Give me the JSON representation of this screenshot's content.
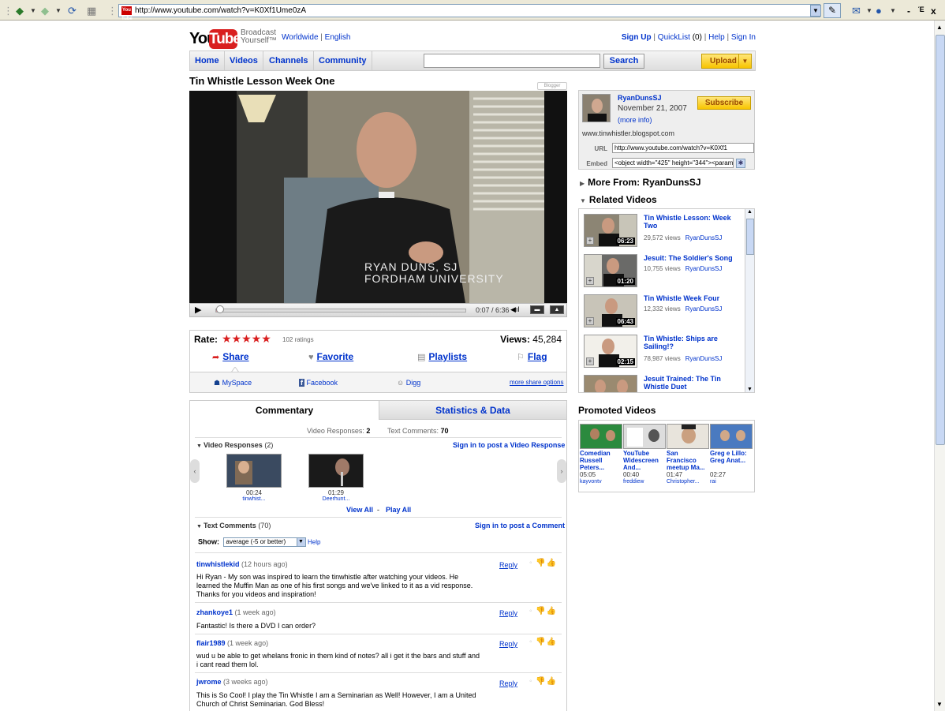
{
  "browser": {
    "url": "http://www.youtube.com/watch?v=K0Xf1Ume0zA",
    "favicon": "You Tube",
    "min": "-",
    "max": "Έ",
    "close": "x"
  },
  "header": {
    "logo_you": "You",
    "logo_tube": "Tube",
    "tagline_1": "Broadcast",
    "tagline_2": "Yourself™",
    "worldwide": "Worldwide",
    "divider": "|",
    "language": "English",
    "signup": "Sign Up",
    "quicklist": "QuickList",
    "quicklist_count": "(0)",
    "help": "Help",
    "signin": "Sign In"
  },
  "nav": {
    "tabs": [
      "Home",
      "Videos",
      "Channels",
      "Community"
    ],
    "search_value": "",
    "search_label": "Search",
    "upload_label": "Upload"
  },
  "video": {
    "title": "Tin Whistle Lesson Week One",
    "blogger_badge": "Blogger",
    "caption_line1": "RYAN DUNS, SJ",
    "caption_line2": "FORDHAM UNIVERSITY",
    "time": "0:07 / 6:36",
    "progress_fraction": 0.018
  },
  "rating": {
    "label": "Rate:",
    "stars": "★★★★★",
    "count": "102 ratings",
    "views_label": "Views:",
    "views": "45,284",
    "actions": {
      "share": "Share",
      "favorite": "Favorite",
      "playlists": "Playlists",
      "flag": "Flag"
    },
    "share_sites": {
      "myspace": "MySpace",
      "facebook": "Facebook",
      "digg": "Digg",
      "more": "more share options"
    }
  },
  "commentary": {
    "tab_active": "Commentary",
    "tab_other": "Statistics & Data",
    "video_responses_label": "Video Responses:",
    "video_responses_count": "2",
    "text_comments_label": "Text Comments:",
    "text_comments_count": "70",
    "vr_header": "Video Responses",
    "vr_header_count": "(2)",
    "vr_signin": "Sign in to post a Video Response",
    "responses": [
      {
        "time": "00:24",
        "user": "tinwhist..."
      },
      {
        "time": "01:29",
        "user": "Deerhunt..."
      }
    ],
    "view_all": "View All",
    "dash": "-",
    "play_all": "Play All",
    "tc_header": "Text Comments",
    "tc_header_count": "(70)",
    "tc_signin": "Sign in to post a Comment",
    "show_label": "Show:",
    "show_value": "average (-5 or better)",
    "help": "Help",
    "reply": "Reply",
    "comments": [
      {
        "user": "tinwhistlekid",
        "time": "(12 hours ago)",
        "text": "Hi Ryan - My son was inspired to learn the tinwhistle after watching your videos. He learned the Muffin Man as one of his first songs and we've linked to it as a vid response. Thanks for you videos and inspiration!"
      },
      {
        "user": "zhankoye1",
        "time": "(1 week ago)",
        "text": "Fantastic! Is there a DVD I can order?"
      },
      {
        "user": "flair1989",
        "time": "(1 week ago)",
        "text": "wud u be able to get whelans fronic in them kind of notes? all i get it the bars and stuff and i cant read them lol."
      },
      {
        "user": "jwrome",
        "time": "(3 weeks ago)",
        "text": "This is So Cool! I play the Tin Whistle I am a Seminarian as Well! However, I am a United Church of Christ Seminarian. God Bless!"
      }
    ]
  },
  "uploader": {
    "name": "RyanDunsSJ",
    "date": "November 21, 2007",
    "more_info": "(more info)",
    "site": "www.tinwhistler.blogspot.com",
    "subscribe": "Subscribe",
    "url_label": "URL",
    "url_value": "http://www.youtube.com/watch?v=K0Xf1",
    "embed_label": "Embed",
    "embed_value": "<object width=\"425\" height=\"344\"><param"
  },
  "sidebar": {
    "more_from": "More From: RyanDunsSJ",
    "related_header": "Related Videos",
    "related": [
      {
        "title": "Tin Whistle Lesson: Week Two",
        "views": "29,572 views",
        "user": "RyanDunsSJ",
        "duration": "06:23"
      },
      {
        "title": "Jesuit: The Soldier's Song",
        "views": "10,755 views",
        "user": "RyanDunsSJ",
        "duration": "01:20"
      },
      {
        "title": "Tin Whistle Week Four",
        "views": "12,332 views",
        "user": "RyanDunsSJ",
        "duration": "06:43"
      },
      {
        "title": "Tin Whistle: Ships are Sailing!?",
        "views": "78,987 views",
        "user": "RyanDunsSJ",
        "duration": "02:15"
      },
      {
        "title": "Jesuit Trained: The Tin Whistle Duet",
        "views": "",
        "user": "",
        "duration": ""
      }
    ],
    "promoted_header": "Promoted Videos",
    "promoted": [
      {
        "title": "Comedian Russell Peters...",
        "duration": "05:05",
        "user": "kayvontv"
      },
      {
        "title": "YouTube Widescreen And...",
        "duration": "00:40",
        "user": "freddiew"
      },
      {
        "title": "San Francisco meetup Ma...",
        "duration": "01:47",
        "user": "Christopher..."
      },
      {
        "title": "Greg e Lillo: Greg Anat...",
        "duration": "02:27",
        "user": "rai"
      }
    ]
  },
  "colors": {
    "brand_red": "#d91f1f",
    "link_blue": "#0033cc",
    "upload_yellow": "#f8c400"
  }
}
